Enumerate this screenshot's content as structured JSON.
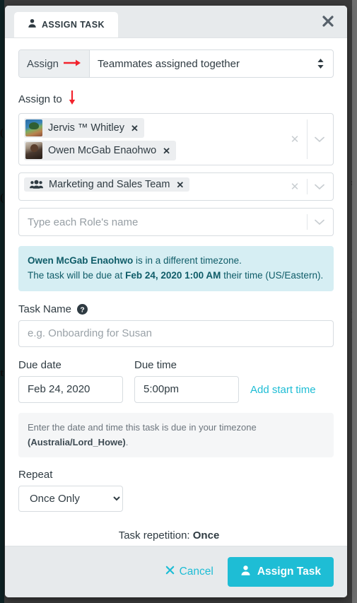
{
  "window": {
    "background_color": "#3b3b3b",
    "scrollbar_color": "#6e6e6e"
  },
  "header": {
    "tab_label": "ASSIGN TASK",
    "tab_icon": "user-icon",
    "close_icon": "close-icon"
  },
  "assign_mode": {
    "prefix_label": "Assign",
    "annotation_icon": "red-right-arrow",
    "selected_value": "Teammates assigned together",
    "caret_icon": "updown-caret-icon"
  },
  "assign_to": {
    "label": "Assign to",
    "annotation_icon": "red-down-arrow",
    "members": [
      {
        "name": "Jervis ™ Whitley",
        "avatar": "jervis-avatar",
        "remove_icon": "remove-tag-icon"
      },
      {
        "name": "Owen McGab Enaohwo",
        "avatar": "owen-avatar",
        "remove_icon": "remove-tag-icon"
      }
    ],
    "members_clear_icon": "clear-icon",
    "members_caret_icon": "chevron-down-icon",
    "teams": [
      {
        "name": "Marketing and Sales Team",
        "icon": "users-group-icon",
        "remove_icon": "remove-tag-icon"
      }
    ],
    "teams_clear_icon": "clear-icon",
    "teams_caret_icon": "chevron-down-icon",
    "roles_placeholder": "Type each Role's name",
    "roles_caret_icon": "chevron-down-icon"
  },
  "timezone_alert": {
    "person": "Owen McGab Enaohwo",
    "line1_rest": " is in a different timezone.",
    "line2_prefix": "The task will be due at ",
    "line2_datetime": "Feb 24, 2020 1:00 AM",
    "line2_suffix": " their time (US/Eastern).",
    "background_color": "#d6eef3",
    "text_color": "#0f5c68"
  },
  "task_name": {
    "label": "Task Name",
    "help_icon": "question-circle-icon",
    "value": "",
    "placeholder": "e.g. Onboarding for Susan"
  },
  "due": {
    "date_label": "Due date",
    "time_label": "Due time",
    "date_value": "Feb 24, 2020",
    "time_value": "5:00pm",
    "add_start_time_label": "Add start time",
    "note_prefix": "Enter the date and time this task is due in your timezone ",
    "note_timezone": "(Australia/Lord_Howe)",
    "note_suffix": "."
  },
  "repeat": {
    "label": "Repeat",
    "selected": "Once Only",
    "options": [
      "Once Only"
    ],
    "repetition_prefix": "Task repetition: ",
    "repetition_value": "Once"
  },
  "footer": {
    "cancel_label": "Cancel",
    "cancel_icon": "x-icon",
    "assign_label": "Assign Task",
    "assign_icon": "user-icon",
    "accent_color": "#1ebdd5"
  }
}
